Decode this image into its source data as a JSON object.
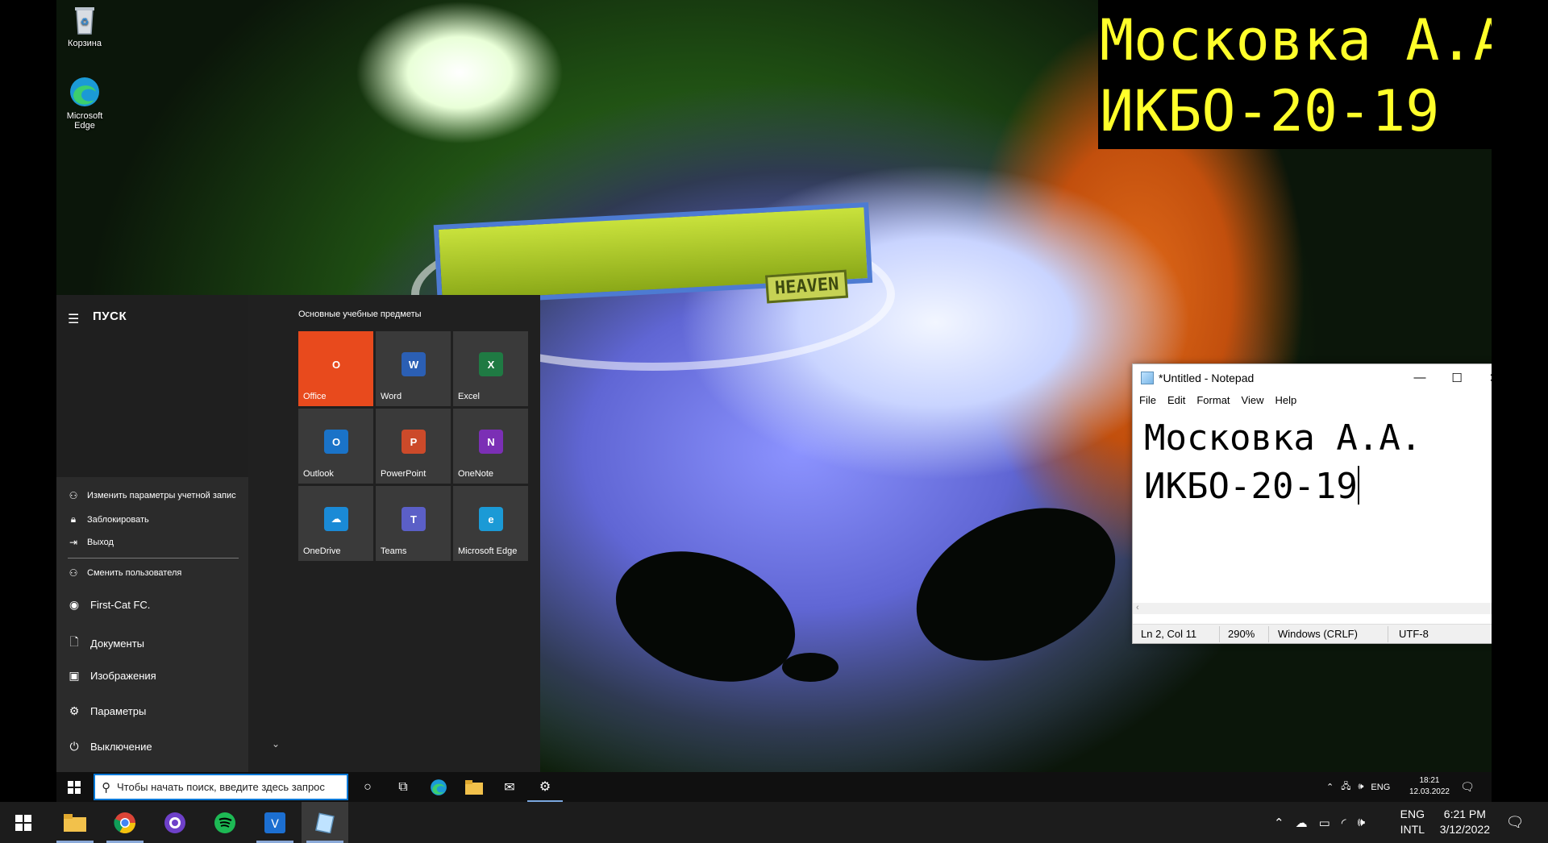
{
  "banner": {
    "line1": "Московка А.А.",
    "line2": "ИКБО-20-19"
  },
  "wallpaper": {
    "label": "HEAVEN"
  },
  "desktop": {
    "icons": [
      {
        "label": "Корзина",
        "icon": "recycle-bin-icon"
      },
      {
        "label": "Microsoft Edge",
        "icon": "edge-icon"
      }
    ]
  },
  "start_menu": {
    "title": "ПУСК",
    "account_items": [
      {
        "label": "Изменить параметры учетной запис",
        "icon": "person-icon"
      },
      {
        "label": "Заблокировать",
        "icon": "lock-icon"
      },
      {
        "label": "Выход",
        "icon": "sign-out-icon"
      }
    ],
    "switch_user": {
      "label": "Сменить пользователя",
      "icon": "switch-user-icon"
    },
    "nav": [
      {
        "label": "First-Cat FC.",
        "icon": "user-avatar-icon"
      },
      {
        "label": "Документы",
        "icon": "documents-icon"
      },
      {
        "label": "Изображения",
        "icon": "pictures-icon"
      },
      {
        "label": "Параметры",
        "icon": "settings-icon"
      },
      {
        "label": "Выключение",
        "icon": "power-icon"
      }
    ],
    "group_title": "Основные учебные предметы",
    "tiles": [
      {
        "label": "Office",
        "glyph": "O",
        "bg": "#e84a1d",
        "icon_bg": "#e84a1d"
      },
      {
        "label": "Word",
        "glyph": "W",
        "bg": "#3a3a3a",
        "icon_bg": "#2b5fb4"
      },
      {
        "label": "Excel",
        "glyph": "X",
        "bg": "#3a3a3a",
        "icon_bg": "#1f7a43"
      },
      {
        "label": "Outlook",
        "glyph": "O",
        "bg": "#3a3a3a",
        "icon_bg": "#1a73c8"
      },
      {
        "label": "PowerPoint",
        "glyph": "P",
        "bg": "#3a3a3a",
        "icon_bg": "#cc4a2a"
      },
      {
        "label": "OneNote",
        "glyph": "N",
        "bg": "#3a3a3a",
        "icon_bg": "#7b2fb5"
      },
      {
        "label": "OneDrive",
        "glyph": "☁",
        "bg": "#3a3a3a",
        "icon_bg": "#1a8ad6"
      },
      {
        "label": "Teams",
        "glyph": "T",
        "bg": "#3a3a3a",
        "icon_bg": "#5b5fc7"
      },
      {
        "label": "Microsoft Edge",
        "glyph": "e",
        "bg": "#3a3a3a",
        "icon_bg": "#1b9ad6"
      }
    ]
  },
  "vm_taskbar": {
    "search_placeholder": "Чтобы начать поиск, введите здесь запрос",
    "tray_lang": "ENG",
    "time": "18:21",
    "date": "12.03.2022"
  },
  "notepad": {
    "title": "*Untitled - Notepad",
    "menu": [
      "File",
      "Edit",
      "Format",
      "View",
      "Help"
    ],
    "text_line1": "Московка А.А.",
    "text_line2": "ИКБО-20-19",
    "status": {
      "position": "Ln 2, Col 11",
      "zoom": "290%",
      "line_ending": "Windows (CRLF)",
      "encoding": "UTF-8"
    }
  },
  "host_taskbar": {
    "lang_line1": "ENG",
    "lang_line2": "INTL",
    "time": "6:21 PM",
    "date": "3/12/2022"
  },
  "colors": {
    "accent": "#0078d7",
    "banner_text": "#ffff2a",
    "office_tile": "#e84a1d"
  }
}
